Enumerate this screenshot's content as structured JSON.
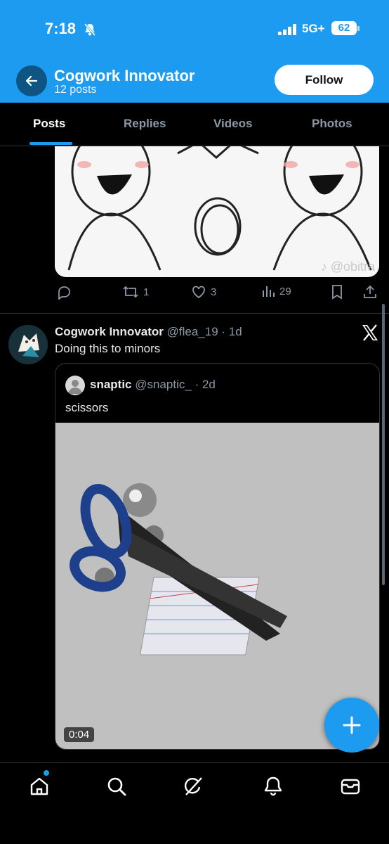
{
  "status_bar": {
    "time": "7:18",
    "network": "5G+",
    "battery": "62"
  },
  "header": {
    "name": "Cogwork Innovator",
    "post_count": "12 posts",
    "follow_label": "Follow"
  },
  "tabs": [
    "Posts",
    "Replies",
    "Videos",
    "Photos"
  ],
  "active_tab": "Posts",
  "prev_post": {
    "watermark": "♪ @obitra",
    "retweets": "1",
    "likes": "3",
    "views": "29"
  },
  "post": {
    "author": "Cogwork Innovator",
    "handle": "@flea_19",
    "age": "· 1d",
    "text": "Doing this to minors",
    "quote": {
      "author": "snaptic",
      "handle": "@snaptic_",
      "age": "· 2d",
      "text": "scissors",
      "video_duration": "0:04"
    }
  },
  "colors": {
    "accent": "#1d9bf0",
    "background": "#000000",
    "muted": "#8b98a5"
  },
  "icons": [
    "back-arrow-icon",
    "bell-off-icon",
    "signal-icon",
    "reply-icon",
    "retweet-icon",
    "like-icon",
    "views-icon",
    "bookmark-icon",
    "share-icon",
    "x-logo-icon",
    "compose-plus-icon",
    "home-icon",
    "search-icon",
    "grok-icon",
    "notifications-icon",
    "messages-icon"
  ]
}
